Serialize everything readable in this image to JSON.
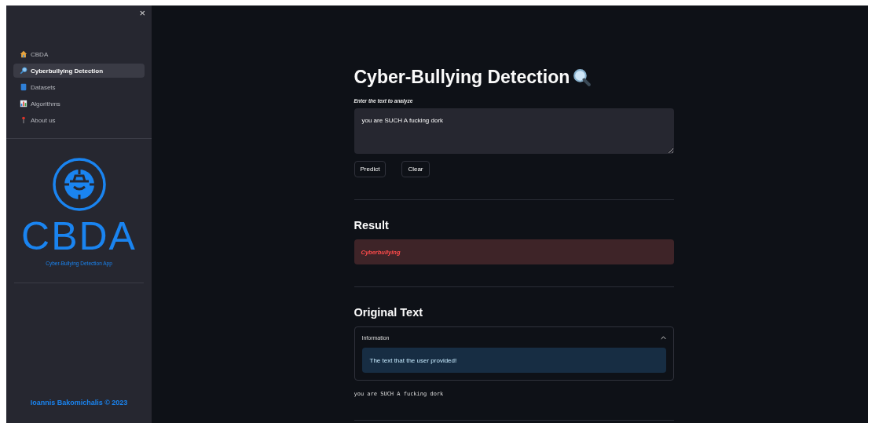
{
  "sidebar": {
    "close": "×",
    "items": [
      {
        "label": "CBDA",
        "kind": "house",
        "selected": false
      },
      {
        "label": "Cyberbullying Detection",
        "kind": "magnifier",
        "selected": true
      },
      {
        "label": "Datasets",
        "kind": "book",
        "selected": false
      },
      {
        "label": "Algorithms",
        "kind": "chart",
        "selected": false
      },
      {
        "label": "About us",
        "kind": "pin",
        "selected": false
      }
    ],
    "logo": {
      "wordmark": "CBDA",
      "tagline": "Cyber-Bullying Detection App"
    },
    "footer": "Ioannis Bakomichalis © 2023"
  },
  "main": {
    "title": "Cyber-Bullying Detection",
    "input": {
      "label": "Enter the text to analyze",
      "value": "you are SUCH A fucking dork"
    },
    "buttons": [
      "Predict",
      "Clear"
    ],
    "result": {
      "heading": "Result",
      "kind": "error",
      "text": "Cyberbullying"
    },
    "original": {
      "heading": "Original Text",
      "expander": {
        "label": "Information",
        "expanded": true,
        "info": "The text that the user provided!"
      },
      "code": "you are SUCH A fucking dork"
    }
  }
}
